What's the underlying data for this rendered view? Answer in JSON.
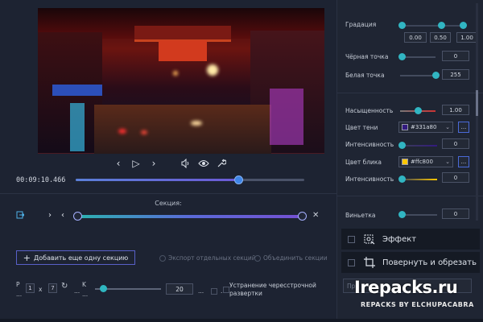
{
  "player": {
    "timecode": "00:09:10.466",
    "seek_progress": 0.71
  },
  "sections": {
    "label": "Секция:",
    "add_button": "Добавить еще одну секцию",
    "export_separate": "Экспорт отдельных секций",
    "merge_sections": "Объединить секции"
  },
  "bottom": {
    "p_label": "P",
    "p_value": "1",
    "x_label": "x",
    "x_value": "7",
    "k_label": "K",
    "ellipsis": "...",
    "slider_value": "20",
    "deinterlace": "Устранение чересстрочной развертки"
  },
  "panel": {
    "gradation": {
      "label": "Градация",
      "values": [
        "0.00",
        "0.50",
        "1.00"
      ]
    },
    "black_point": {
      "label": "Чёрная точка",
      "value": "0"
    },
    "white_point": {
      "label": "Белая точка",
      "value": "255"
    },
    "saturation": {
      "label": "Насыщенность",
      "value": "1.00"
    },
    "shadow_color": {
      "label": "Цвет тени",
      "value": "#331a80",
      "swatch": "#331a80"
    },
    "shadow_intensity": {
      "label": "Интенсивность",
      "value": "0"
    },
    "highlight_color": {
      "label": "Цвет блика",
      "value": "#ffc800",
      "swatch": "#ffc800"
    },
    "highlight_intensity": {
      "label": "Интенсивность",
      "value": "0"
    },
    "vignette": {
      "label": "Виньетка",
      "value": "0"
    },
    "dots": "...",
    "effect": "Эффект",
    "rotate_crop": "Повернуть и обрезать",
    "presets_placeholder": "Пр"
  },
  "watermark": {
    "main": "Irepacks.ru",
    "sub": "REPACKS BY ELCHUPACABRA"
  },
  "colors": {
    "accent": "#31b5c2",
    "seek": "#3f86e8",
    "button_border": "#5860c8"
  }
}
